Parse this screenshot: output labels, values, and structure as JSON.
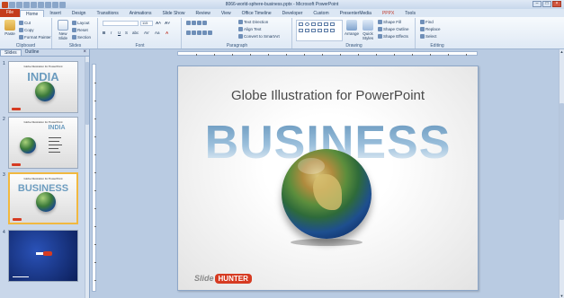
{
  "window": {
    "title": "8066-world-sphere-business.pptx - Microsoft PowerPoint"
  },
  "tabs": {
    "file": "File",
    "items": [
      "Home",
      "Insert",
      "Design",
      "Transitions",
      "Animations",
      "Slide Show",
      "Review",
      "View",
      "Office Timeline",
      "Developer",
      "Custom",
      "PresenterMedia",
      "PPPX",
      "Tools"
    ],
    "active": "Home"
  },
  "ribbon": {
    "clipboard": {
      "label": "Clipboard",
      "paste": "Paste",
      "cut": "Cut",
      "copy": "Copy",
      "format_painter": "Format Painter"
    },
    "slides": {
      "label": "Slides",
      "new_slide": "New Slide",
      "layout": "Layout",
      "reset": "Reset",
      "section": "Section"
    },
    "font": {
      "label": "Font",
      "size": "115"
    },
    "paragraph": {
      "label": "Paragraph",
      "text_direction": "Text Direction",
      "align_text": "Align Text",
      "convert": "Convert to SmartArt"
    },
    "drawing": {
      "label": "Drawing",
      "arrange": "Arrange",
      "quick_styles": "Quick Styles",
      "shape_fill": "Shape Fill",
      "shape_outline": "Shape Outline",
      "shape_effects": "Shape Effects"
    },
    "editing": {
      "label": "Editing",
      "find": "Find",
      "replace": "Replace",
      "select": "Select"
    }
  },
  "panes": {
    "slides_tab": "Slides",
    "outline_tab": "Outline",
    "close": "×"
  },
  "thumbnails": [
    {
      "num": "1",
      "title": "Globe Illustration for PowerPoint",
      "big": "INDIA"
    },
    {
      "num": "2",
      "title": "Globe Illustration for PowerPoint",
      "big": "INDIA"
    },
    {
      "num": "3",
      "title": "Globe Illustration for PowerPoint",
      "big": "BUSINESS"
    },
    {
      "num": "4",
      "title": "",
      "big": ""
    }
  ],
  "slide": {
    "title": "Globe Illustration for PowerPoint",
    "big_text": "BUSINESS",
    "logo_text": "Slide",
    "logo_badge": "HUNTER"
  }
}
